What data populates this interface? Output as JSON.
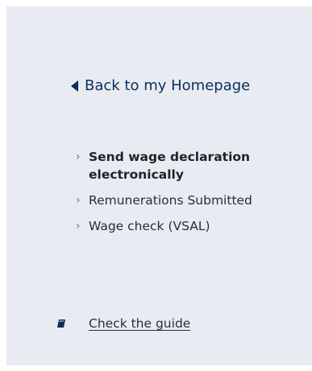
{
  "back": {
    "label": "Back to my Homepage"
  },
  "menu": {
    "items": [
      {
        "label": "Send wage declaration electronically",
        "active": true
      },
      {
        "label": "Remunerations Submitted",
        "active": false
      },
      {
        "label": "Wage check (VSAL)",
        "active": false
      }
    ]
  },
  "guide": {
    "label": "Check the guide",
    "icon": "book-icon"
  },
  "colors": {
    "panel_bg": "#e8ecf2",
    "back_link": "#0b2d5b",
    "chevron": "#2e86c1",
    "text": "#2a2d33"
  }
}
